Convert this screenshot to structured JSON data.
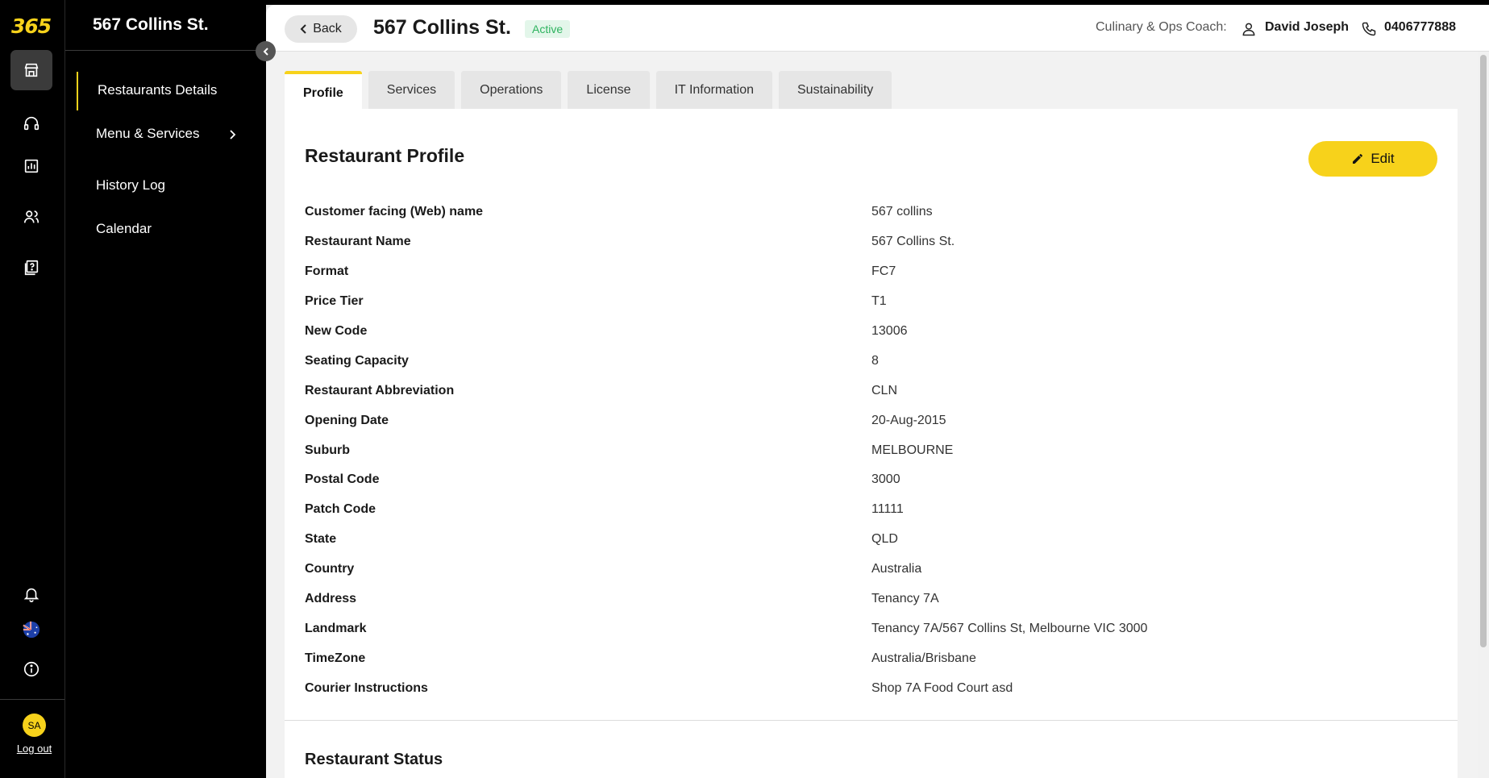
{
  "app": {
    "logo": "365"
  },
  "rail": {
    "items": [
      "store-icon",
      "headset-icon",
      "chart-icon",
      "users-icon",
      "help-book-icon"
    ],
    "bottom": [
      "bell-icon",
      "australia-flag-icon",
      "info-icon"
    ],
    "avatar": "SA",
    "logout": "Log out"
  },
  "sidenav": {
    "title": "567 Collins St.",
    "items": [
      {
        "label": "Restaurants Details"
      },
      {
        "label": "Menu & Services"
      },
      {
        "label": "History Log"
      },
      {
        "label": "Calendar"
      }
    ]
  },
  "header": {
    "back_label": "Back",
    "title": "567 Collins St.",
    "status": "Active",
    "coach_label": "Culinary & Ops Coach:",
    "coach_name": "David Joseph",
    "phone": "0406777888"
  },
  "tabs": [
    "Profile",
    "Services",
    "Operations",
    "License",
    "IT Information",
    "Sustainability"
  ],
  "profile": {
    "title": "Restaurant Profile",
    "edit_label": "Edit",
    "rows": [
      {
        "label": "Customer facing (Web) name",
        "value": "567 collins"
      },
      {
        "label": "Restaurant Name",
        "value": "567 Collins St."
      },
      {
        "label": "Format",
        "value": "FC7"
      },
      {
        "label": "Price Tier",
        "value": "T1"
      },
      {
        "label": "New Code",
        "value": "13006"
      },
      {
        "label": "Seating Capacity",
        "value": "8"
      },
      {
        "label": "Restaurant Abbreviation",
        "value": "CLN"
      },
      {
        "label": "Opening Date",
        "value": "20-Aug-2015"
      },
      {
        "label": "Suburb",
        "value": "MELBOURNE"
      },
      {
        "label": "Postal Code",
        "value": "3000"
      },
      {
        "label": "Patch Code",
        "value": "11111"
      },
      {
        "label": "State",
        "value": "QLD"
      },
      {
        "label": "Country",
        "value": "Australia"
      },
      {
        "label": "Address",
        "value": "Tenancy 7A"
      },
      {
        "label": "Landmark",
        "value": "Tenancy 7A/567 Collins St, Melbourne VIC 3000"
      },
      {
        "label": "TimeZone",
        "value": "Australia/Brisbane"
      },
      {
        "label": "Courier Instructions",
        "value": "Shop 7A Food Court asd"
      }
    ]
  },
  "status_section": {
    "title": "Restaurant Status"
  },
  "colors": {
    "accent": "#f7d21b",
    "active_badge": "#2eb35f"
  }
}
